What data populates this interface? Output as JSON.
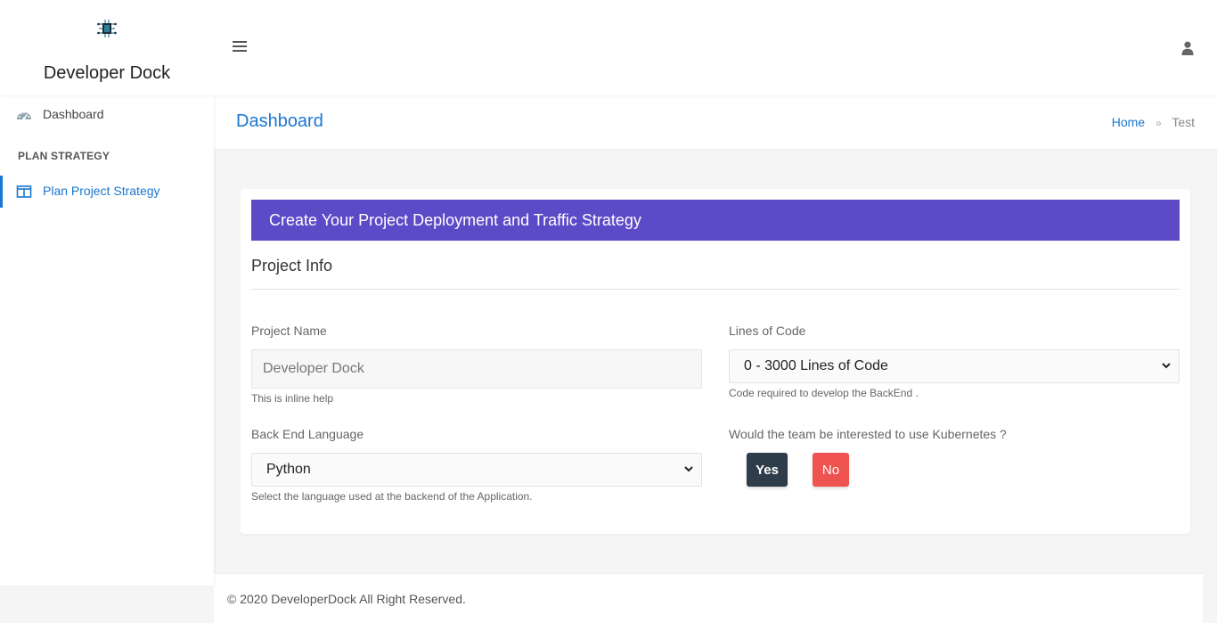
{
  "brand": {
    "name": "Developer Dock",
    "logo_icon": "chip-icon"
  },
  "header": {
    "menu_icon": "hamburger-icon",
    "user_icon": "user-icon"
  },
  "sidebar": {
    "items": [
      {
        "label": "Dashboard",
        "icon": "dashboard-gauge-icon",
        "active": false
      },
      {
        "label": "Plan Project Strategy",
        "icon": "columns-icon",
        "active": true
      }
    ],
    "heading": "PLAN STRATEGY"
  },
  "page": {
    "title": "Dashboard",
    "breadcrumb": {
      "home": "Home",
      "separator": "»",
      "current": "Test"
    }
  },
  "card": {
    "header": "Create Your Project Deployment and Traffic Strategy",
    "section_title": "Project Info",
    "fields": {
      "project_name": {
        "label": "Project Name",
        "placeholder": "Developer Dock",
        "help": "This is inline help"
      },
      "lines_of_code": {
        "label": "Lines of Code",
        "value": "0 - 3000 Lines of Code",
        "help": "Code required to develop the BackEnd ."
      },
      "backend_language": {
        "label": "Back End Language",
        "value": "Python",
        "help": "Select the language used at the backend of the Application."
      },
      "kubernetes": {
        "label": "Would the team be interested to use Kubernetes ?",
        "yes": "Yes",
        "no": "No"
      }
    }
  },
  "footer": {
    "text": "© 2020 DeveloperDock All Right Reserved."
  },
  "colors": {
    "accent": "#1976d2",
    "card_header": "#5c4ac7",
    "yes_button": "#2f3d4a",
    "no_button": "#ef5350"
  }
}
